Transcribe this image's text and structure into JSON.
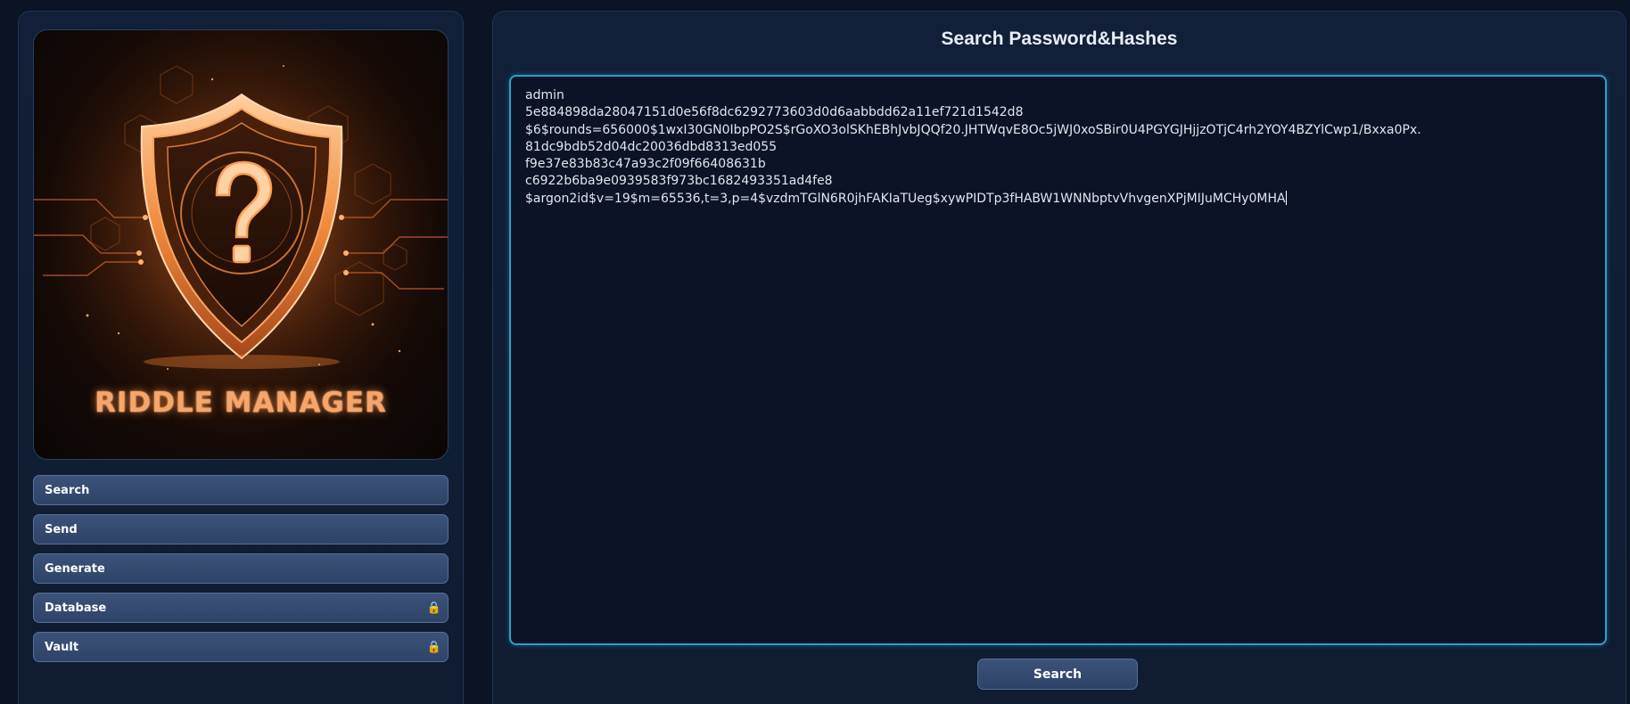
{
  "logo": {
    "title": "RIDDLE MANAGER",
    "emblem": "shield-question-icon"
  },
  "sidebar": {
    "items": [
      {
        "label": "Search",
        "locked": false
      },
      {
        "label": "Send",
        "locked": false
      },
      {
        "label": "Generate",
        "locked": false
      },
      {
        "label": "Database",
        "locked": true,
        "icon": "lock-icon"
      },
      {
        "label": "Vault",
        "locked": true,
        "icon": "lock-icon"
      }
    ]
  },
  "main": {
    "title": "Search Password&Hashes",
    "input_lines": [
      "admin",
      "5e884898da28047151d0e56f8dc6292773603d0d6aabbdd62a11ef721d1542d8",
      "$6$rounds=656000$1wxI30GN0IbpPO2S$rGoXO3olSKhEBhJvbJQQf20.JHTWqvE8Oc5jWJ0xoSBir0U4PGYGJHjjzOTjC4rh2YOY4BZYlCwp1/Bxxa0Px.",
      "81dc9bdb52d04dc20036dbd8313ed055",
      "f9e37e83b83c47a93c2f09f66408631b",
      "c6922b6ba9e0939583f973bc1682493351ad4fe8",
      "$argon2id$v=19$m=65536,t=3,p=4$vzdmTGlN6R0jhFAKIaTUeg$xywPIDTp3fHABW1WNNbptvVhvgenXPjMIJuMCHy0MHA"
    ],
    "search_button": "Search"
  },
  "colors": {
    "background": "#0b1424",
    "panel": "#112038",
    "button": "#34496f",
    "input_border": "#2fa0c8",
    "logo_accent": "#f6a56b",
    "lock": "#f3c24c"
  }
}
